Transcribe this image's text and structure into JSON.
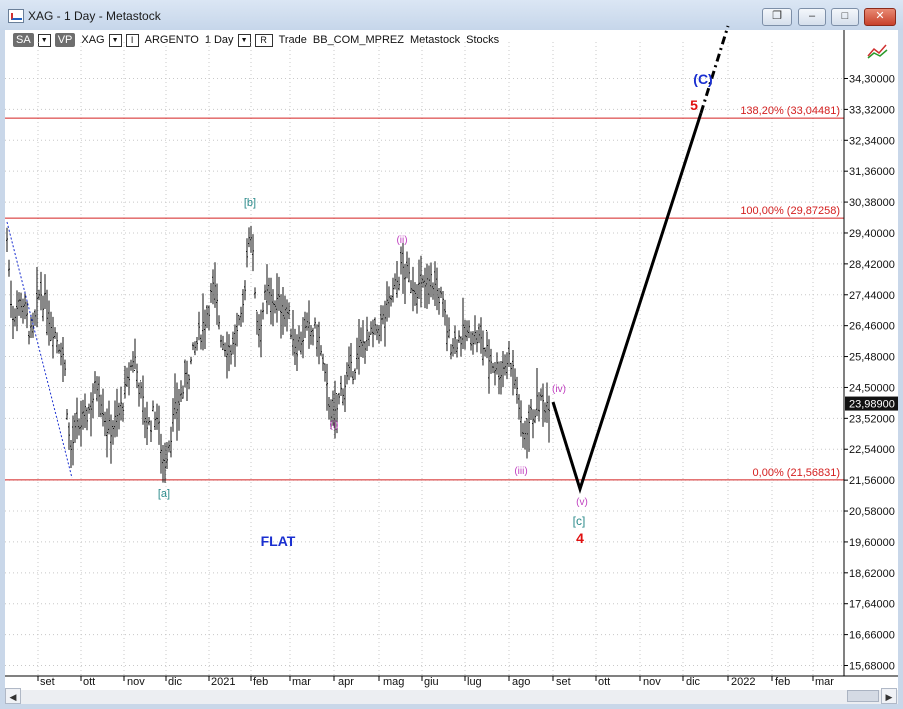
{
  "window": {
    "title": "XAG - 1 Day - Metastock",
    "buttons": [
      "restore-down",
      "minimize",
      "maximize",
      "close"
    ]
  },
  "toolbar": {
    "chip_sa": "SA",
    "chip_vp": "VP",
    "symbol": "XAG",
    "indicator_marker": "I",
    "instrument_name": "ARGENTO",
    "timeframe": "1 Day",
    "r_marker": "R",
    "trade_text": "Trade",
    "template": "BB_COM_MPREZ",
    "source": "Metastock",
    "category": "Stocks"
  },
  "chart_data": {
    "type": "ohlc-bar",
    "symbol": "XAG",
    "price_axis": {
      "min": 15.68,
      "max": 35.28,
      "ticks": [
        "34,30000",
        "33,32000",
        "32,34000",
        "31,36000",
        "30,38000",
        "29,40000",
        "28,42000",
        "27,44000",
        "26,46000",
        "25,48000",
        "24,50000",
        "23,52000",
        "22,54000",
        "21,56000",
        "20,58000",
        "19,60000",
        "18,62000",
        "17,64000",
        "16,66000",
        "15,68000"
      ]
    },
    "last_price_label": "23,98900",
    "last_price": 23.989,
    "time_axis": {
      "labels": [
        "set",
        "ott",
        "nov",
        "dic",
        "2021",
        "feb",
        "mar",
        "apr",
        "mag",
        "giu",
        "lug",
        "ago",
        "set",
        "ott",
        "nov",
        "dic",
        "2022",
        "feb",
        "mar"
      ]
    },
    "fib_levels": [
      {
        "label": "138,20% (33,04481)",
        "value": 33.04481
      },
      {
        "label": "100,00% (29,87258)",
        "value": 29.87258
      },
      {
        "label": "0,00% (21,56831)",
        "value": 21.56831
      }
    ],
    "wave_labels": [
      {
        "text": "[b]",
        "color": "#2a8a8a"
      },
      {
        "text": "[a]",
        "color": "#2a8a8a"
      },
      {
        "text": "[c]",
        "color": "#2a8a8a"
      },
      {
        "text": "(ii)",
        "color": "#c040c0"
      },
      {
        "text": "(i)",
        "color": "#c040c0"
      },
      {
        "text": "(iii)",
        "color": "#c040c0"
      },
      {
        "text": "(iv)",
        "color": "#c040c0"
      },
      {
        "text": "(v)",
        "color": "#c040c0"
      },
      {
        "text": "(C)",
        "color": "#1a2fd0"
      },
      {
        "text": "5",
        "color": "#e01010"
      },
      {
        "text": "4",
        "color": "#e01010"
      },
      {
        "text": "FLAT",
        "color": "#1a2fd0"
      }
    ],
    "grid": "dotted-vertical-and-horizontal",
    "colors": {
      "bars": "#111111",
      "fib_line": "#d42020",
      "projection": "#000000",
      "wave_a_line": "#1a2fd0"
    }
  }
}
